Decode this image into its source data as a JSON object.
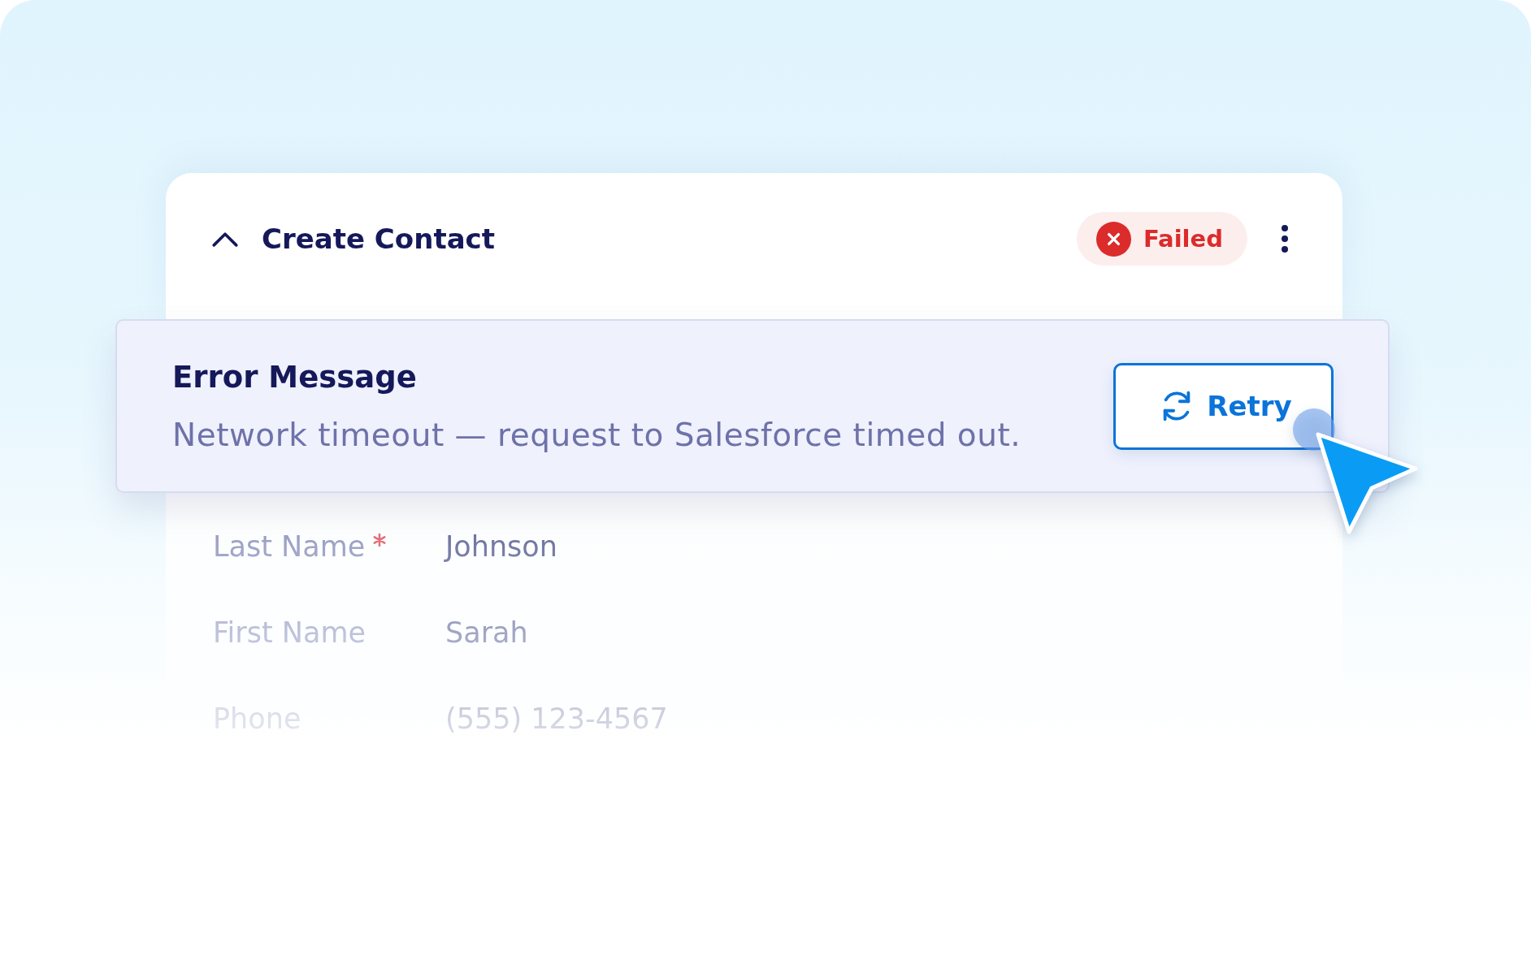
{
  "step": {
    "title": "Create Contact",
    "expanded": true,
    "status": {
      "kind": "failed",
      "label": "Failed"
    }
  },
  "error": {
    "title": "Error Message",
    "message": "Network timeout — request to Salesforce timed out.",
    "action": "Retry"
  },
  "fields": [
    {
      "label": "Last Name",
      "required": true,
      "value": "Johnson"
    },
    {
      "label": "First Name",
      "required": false,
      "value": "Sarah"
    },
    {
      "label": "Phone",
      "required": false,
      "value": "(555) 123-4567"
    }
  ]
}
